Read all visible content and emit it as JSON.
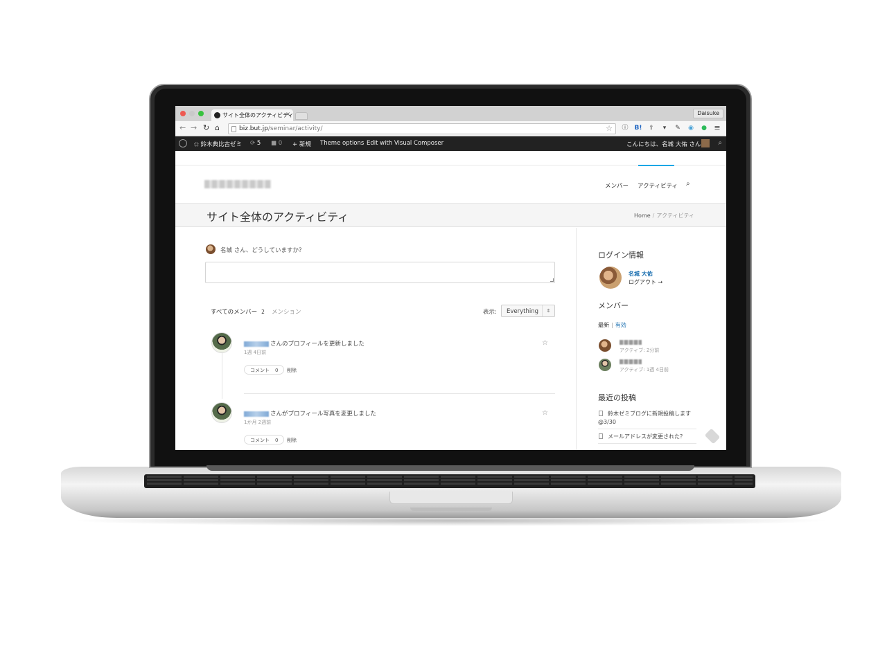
{
  "browser": {
    "tab_title": "サイト全体のアクティビティ",
    "tab_close": "×",
    "profile": "Daisuke",
    "url_host": "biz.but.jp",
    "url_path": "/seminar/activity/",
    "nav_icons": [
      "back-icon",
      "forward-icon",
      "reload-icon",
      "home-icon"
    ],
    "extension_labels": [
      "ⓘ",
      "B!",
      "⇪",
      "▾",
      "✎",
      "◉",
      "●",
      "≡"
    ]
  },
  "wp_admin_bar": {
    "site_name": "鈴木典比古ゼミ",
    "updates_count": "5",
    "comments_count": "0",
    "new_label": "新規",
    "theme_options": "Theme options",
    "visual_composer": "Edit with Visual Composer",
    "greeting": "こんにちは、名城 大佑 さん！"
  },
  "site": {
    "nav": [
      "メンバー",
      "アクティビティ"
    ],
    "page_title": "サイト全体のアクティビティ",
    "breadcrumb": {
      "home": "Home",
      "separator": "/",
      "current": "アクティビティ"
    }
  },
  "post_form": {
    "prompt": "名城 さん、どうしていますか？"
  },
  "activity_tabs": {
    "all_members": "すべてのメンバー",
    "all_count": "2",
    "mentions": "メンション",
    "filter_label": "表示:",
    "filter_value": "Everything"
  },
  "activities": [
    {
      "text": "さんのプロフィールを更新しました",
      "time": "1週 4日前",
      "comment_label": "コメント",
      "comment_count": "0",
      "delete_label": "削除"
    },
    {
      "text": "さんがプロフィール写真を変更しました",
      "time": "1か月 2週前",
      "comment_label": "コメント",
      "comment_count": "0",
      "delete_label": "削除"
    }
  ],
  "sidebar": {
    "login_title": "ログイン情報",
    "login_name": "名城 大佑",
    "logout": "ログアウト →",
    "members_title": "メンバー",
    "members_tabs": {
      "newest": "最新",
      "separator": "|",
      "active": "有効"
    },
    "members": [
      {
        "active": "アクティブ: 2分前"
      },
      {
        "active": "アクティブ: 1週 4日前"
      }
    ],
    "recent_posts_title": "最近の投稿",
    "recent_posts": [
      "鈴木ゼミブログに新規投稿します @3/30",
      "メールアドレスが変更された？"
    ]
  },
  "colors": {
    "accent": "#1aa7e5",
    "link": "#1a6fb0",
    "admin_bar": "#222222"
  }
}
